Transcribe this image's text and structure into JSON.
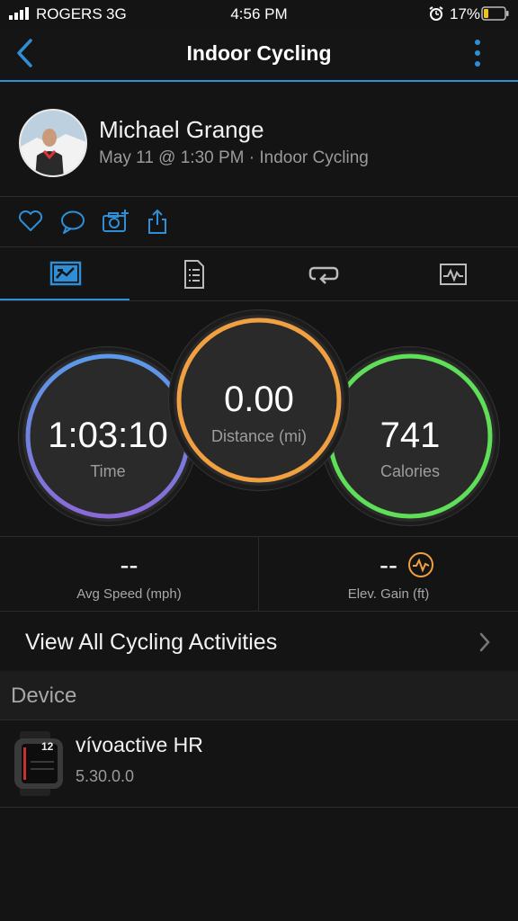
{
  "status_bar": {
    "carrier": "ROGERS",
    "network": "3G",
    "time": "4:56 PM",
    "battery": "17%"
  },
  "nav": {
    "title": "Indoor Cycling"
  },
  "profile": {
    "name": "Michael Grange",
    "meta": "May 11 @ 1:30 PM · Indoor Cycling"
  },
  "tabs": [
    {
      "icon": "stats-chart-icon",
      "active": true
    },
    {
      "icon": "document-list-icon",
      "active": false
    },
    {
      "icon": "laps-loop-icon",
      "active": false
    },
    {
      "icon": "activity-graph-icon",
      "active": false
    }
  ],
  "metrics": {
    "time": {
      "value": "1:03:10",
      "label": "Time"
    },
    "distance": {
      "value": "0.00",
      "label": "Distance (mi)"
    },
    "calories": {
      "value": "741",
      "label": "Calories"
    }
  },
  "stats": {
    "avg_speed": {
      "value": "--",
      "label": "Avg Speed (mph)"
    },
    "elev_gain": {
      "value": "--",
      "label": "Elev. Gain (ft)"
    }
  },
  "view_all": {
    "label": "View All Cycling Activities"
  },
  "device_section": {
    "header": "Device",
    "name": "vívoactive HR",
    "version": "5.30.0.0",
    "watch_face_text": "12"
  },
  "colors": {
    "accent_blue": "#2f8fd6",
    "time_ring": "#5b8fe0",
    "distance_ring": "#f0a040",
    "calories_ring": "#5fdf58"
  }
}
